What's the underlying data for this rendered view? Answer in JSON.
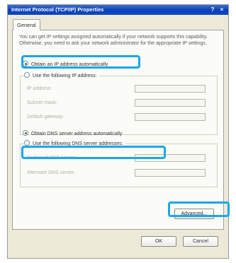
{
  "window": {
    "title": "Internet Protocol (TCP/IP) Properties",
    "help_glyph": "?",
    "close_glyph": "×"
  },
  "tabs": [
    {
      "label": "General",
      "selected": true
    }
  ],
  "description": "You can get IP settings assigned automatically if your network supports this capability. Otherwise, you need to ask your network administrator for the appropriate IP settings.",
  "ip_section": {
    "auto_option": {
      "label": "Obtain an IP address automatically",
      "checked": true
    },
    "manual_option": {
      "label": "Use the following IP address:",
      "checked": false
    },
    "fields": [
      {
        "label": "IP address:",
        "value": ""
      },
      {
        "label": "Subnet mask:",
        "value": ""
      },
      {
        "label": "Default gateway:",
        "value": ""
      }
    ]
  },
  "dns_section": {
    "auto_option": {
      "label": "Obtain DNS server address automatically",
      "checked": true
    },
    "manual_option": {
      "label": "Use the following DNS server addresses:",
      "checked": false
    },
    "fields": [
      {
        "label": "Preferred DNS server:",
        "value": ""
      },
      {
        "label": "Alternate DNS server:",
        "value": ""
      }
    ]
  },
  "buttons": {
    "advanced": "Advanced...",
    "ok": "OK",
    "cancel": "Cancel"
  },
  "colors": {
    "highlight": "#1aa7e6",
    "title_bar": "#0a3fb8",
    "dialog_face": "#ece9d8"
  }
}
